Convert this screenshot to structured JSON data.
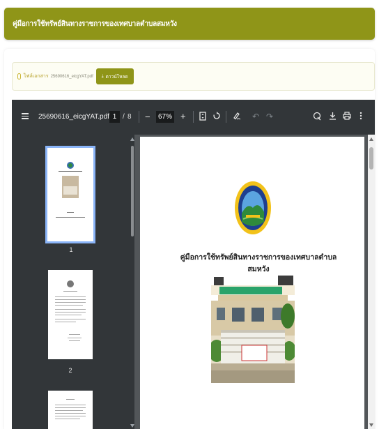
{
  "header": {
    "title": "คู่มือการใช้ทรัพย์สินทางราชการของเทศบาลตำบลสมหวัง"
  },
  "attachment": {
    "label": "ไฟล์เอกสาร",
    "filename": "25690616_eicgYAT.pdf",
    "download_label": "ดาวน์โหลด"
  },
  "viewer": {
    "filename": "25690616_eicgYAT.pdf",
    "current_page": "1",
    "separator": "/",
    "total_pages": "8",
    "zoom": "67%",
    "thumbnails": [
      {
        "number": "1",
        "selected": true
      },
      {
        "number": "2",
        "selected": false
      }
    ]
  },
  "document": {
    "title": "คู่มือการใช้ทรัพย์สินทางราชการของเทศบาลตำบลสมหวัง",
    "seal_text_top": "เทศบาลตำบลสมหวัง",
    "seal_text_bottom": "จังหวัดพัทลุง",
    "photo_sign_text": "เทศบาลตำบลสมหวัง"
  },
  "colors": {
    "accent": "#8f9518",
    "toolbar": "#323639",
    "viewer_bg": "#525659"
  }
}
